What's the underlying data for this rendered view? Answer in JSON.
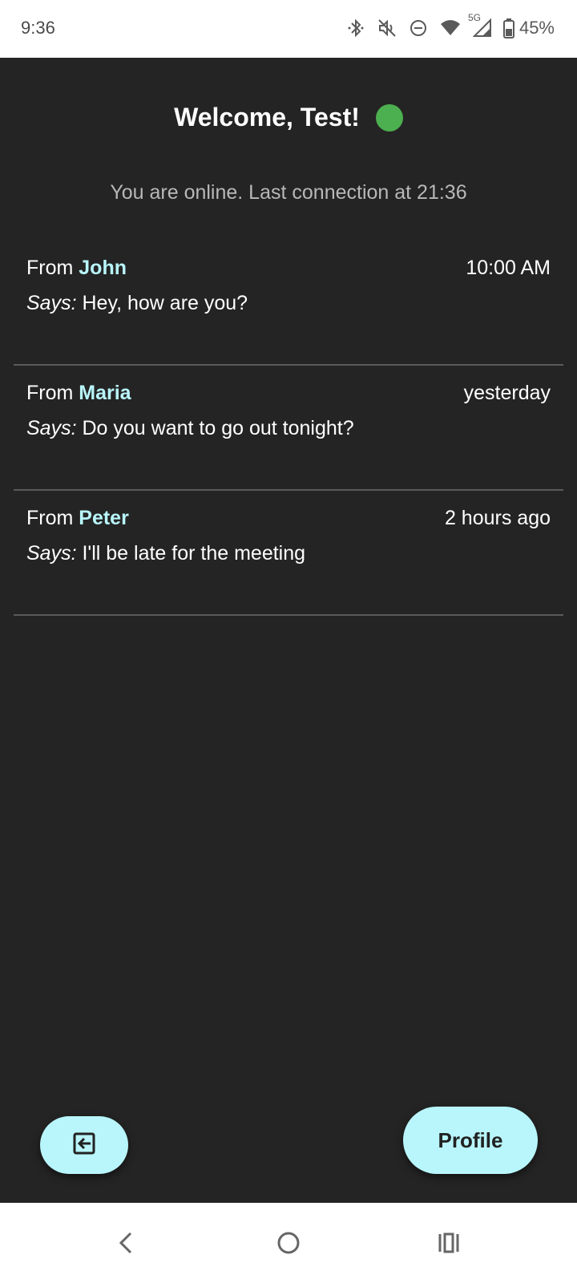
{
  "status_bar": {
    "time": "9:36",
    "network": "5G",
    "battery": "45%",
    "icons": [
      "bluetooth-icon",
      "mute-icon",
      "dnd-icon",
      "wifi-icon",
      "signal-icon",
      "battery-icon"
    ]
  },
  "header": {
    "welcome": "Welcome, Test!",
    "online_color": "#4caf50"
  },
  "status_text": "You are online. Last connection at 21:36",
  "messages": [
    {
      "from_label": "From",
      "sender": "John",
      "time": "10:00 AM",
      "says_label": "Says:",
      "text": "Hey, how are you?"
    },
    {
      "from_label": "From",
      "sender": "Maria",
      "time": "yesterday",
      "says_label": "Says:",
      "text": "Do you want to go out tonight?"
    },
    {
      "from_label": "From",
      "sender": "Peter",
      "time": "2 hours ago",
      "says_label": "Says:",
      "text": "I'll be late for the meeting"
    }
  ],
  "buttons": {
    "logout_icon": "logout-icon",
    "profile": "Profile"
  },
  "colors": {
    "background": "#242424",
    "accent": "#b8f6fb"
  },
  "nav": {
    "icons": [
      "back-icon",
      "home-icon",
      "recents-icon"
    ]
  }
}
